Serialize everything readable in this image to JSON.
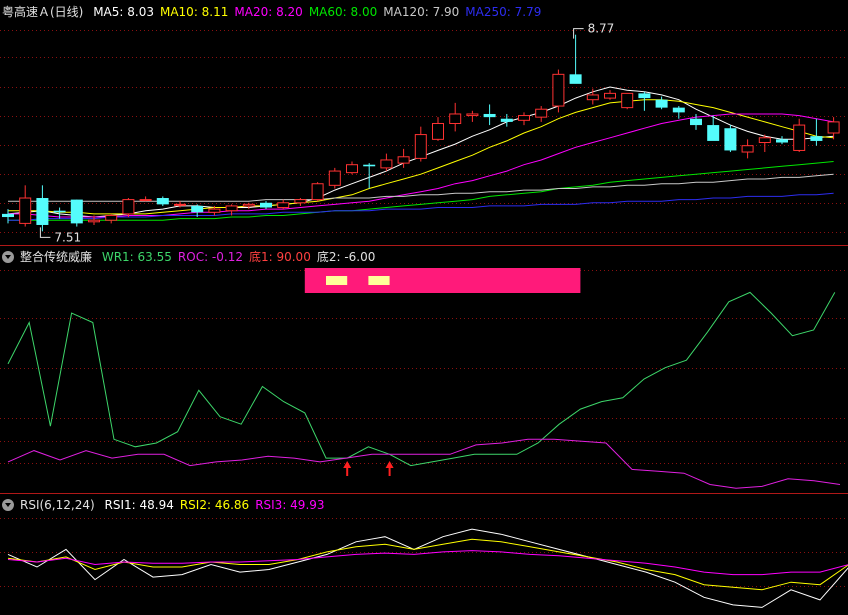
{
  "colors": {
    "bg": "#000000",
    "up": "#ff3232",
    "down": "#54fcfc",
    "ma5": "#ffffff",
    "ma10": "#ffff00",
    "ma20": "#ff00ff",
    "ma60": "#00e600",
    "ma120": "#c8c8c8",
    "ma250": "#2d2df0",
    "wr": "#3dd66a",
    "roc": "#e020e0",
    "label": "#e0e0e0",
    "grid": "#8a1010",
    "sep": "#b01818",
    "band": "#ff1a7a",
    "bandbox": "#ffff99"
  },
  "price_panel": {
    "name": "粤高速Ａ(日线)",
    "legend": [
      {
        "text": "MA5: 8.03",
        "color": "#ffffff"
      },
      {
        "text": "MA10: 8.11",
        "color": "#ffff00"
      },
      {
        "text": "MA20: 8.20",
        "color": "#ff00ff"
      },
      {
        "text": "MA60: 8.00",
        "color": "#00e600"
      },
      {
        "text": "MA120: 7.90",
        "color": "#c8c8c8"
      },
      {
        "text": "MA250: 7.79",
        "color": "#2d2df0"
      }
    ],
    "high_label": "8.77",
    "low_label": "7.51"
  },
  "ind_panel": {
    "name": "整合传统威廉",
    "legend": [
      {
        "text": "WR1: 63.55",
        "color": "#3dd66a"
      },
      {
        "text": "ROC: -0.12",
        "color": "#e020e0"
      },
      {
        "text": "底1: 90.00",
        "color": "#ff4040"
      },
      {
        "text": "底2: -6.00",
        "color": "#e0e0e0"
      }
    ]
  },
  "rsi_panel": {
    "name": "RSI(6,12,24)",
    "legend": [
      {
        "text": "RSI1: 48.94",
        "color": "#ffffff"
      },
      {
        "text": "RSI2: 46.86",
        "color": "#ffff00"
      },
      {
        "text": "RSI3: 49.93",
        "color": "#ff00ff"
      }
    ]
  },
  "chart_data": [
    {
      "type": "candlestick",
      "ylim": [
        7.45,
        8.85
      ],
      "series": [
        {
          "name": "K",
          "ohlc": [
            [
              7.64,
              7.67,
              7.58,
              7.62
            ],
            [
              7.58,
              7.82,
              7.56,
              7.74
            ],
            [
              7.74,
              7.82,
              7.53,
              7.57
            ],
            [
              7.66,
              7.68,
              7.61,
              7.65
            ],
            [
              7.73,
              7.73,
              7.56,
              7.58
            ],
            [
              7.59,
              7.63,
              7.57,
              7.6
            ],
            [
              7.6,
              7.64,
              7.58,
              7.63
            ],
            [
              7.64,
              7.74,
              7.62,
              7.73
            ],
            [
              7.73,
              7.75,
              7.72,
              7.73
            ],
            [
              7.74,
              7.75,
              7.69,
              7.7
            ],
            [
              7.7,
              7.72,
              7.68,
              7.7
            ],
            [
              7.69,
              7.7,
              7.62,
              7.65
            ],
            [
              7.65,
              7.69,
              7.63,
              7.67
            ],
            [
              7.66,
              7.7,
              7.63,
              7.69
            ],
            [
              7.69,
              7.71,
              7.67,
              7.7
            ],
            [
              7.71,
              7.72,
              7.67,
              7.68
            ],
            [
              7.68,
              7.73,
              7.67,
              7.71
            ],
            [
              7.71,
              7.74,
              7.69,
              7.73
            ],
            [
              7.73,
              7.84,
              7.72,
              7.83
            ],
            [
              7.82,
              7.93,
              7.8,
              7.91
            ],
            [
              7.9,
              7.97,
              7.89,
              7.95
            ],
            [
              7.95,
              7.96,
              7.8,
              7.94
            ],
            [
              7.93,
              8.02,
              7.91,
              7.98
            ],
            [
              7.96,
              8.05,
              7.93,
              8.0
            ],
            [
              7.99,
              8.19,
              7.97,
              8.14
            ],
            [
              8.11,
              8.25,
              8.1,
              8.21
            ],
            [
              8.21,
              8.34,
              8.16,
              8.27
            ],
            [
              8.26,
              8.29,
              8.22,
              8.27
            ],
            [
              8.27,
              8.33,
              8.2,
              8.25
            ],
            [
              8.24,
              8.27,
              8.19,
              8.22
            ],
            [
              8.23,
              8.28,
              8.2,
              8.26
            ],
            [
              8.25,
              8.32,
              8.22,
              8.3
            ],
            [
              8.32,
              8.55,
              8.28,
              8.52
            ],
            [
              8.52,
              8.77,
              8.48,
              8.46
            ],
            [
              8.36,
              8.43,
              8.33,
              8.39
            ],
            [
              8.37,
              8.42,
              8.36,
              8.4
            ],
            [
              8.31,
              8.4,
              8.3,
              8.4
            ],
            [
              8.4,
              8.41,
              8.29,
              8.37
            ],
            [
              8.36,
              8.38,
              8.3,
              8.31
            ],
            [
              8.31,
              8.32,
              8.24,
              8.28
            ],
            [
              8.24,
              8.27,
              8.17,
              8.2
            ],
            [
              8.2,
              8.26,
              8.11,
              8.1
            ],
            [
              8.18,
              8.2,
              8.03,
              8.04
            ],
            [
              8.03,
              8.11,
              7.99,
              8.07
            ],
            [
              8.09,
              8.14,
              8.03,
              8.12
            ],
            [
              8.11,
              8.13,
              8.08,
              8.09
            ],
            [
              8.04,
              8.24,
              8.03,
              8.2
            ],
            [
              8.13,
              8.24,
              8.07,
              8.1
            ],
            [
              8.15,
              8.25,
              8.11,
              8.22
            ]
          ]
        },
        {
          "name": "MA5",
          "values": [
            7.64,
            7.65,
            7.66,
            7.64,
            7.63,
            7.62,
            7.63,
            7.64,
            7.66,
            7.67,
            7.69,
            7.69,
            7.68,
            7.68,
            7.68,
            7.69,
            7.7,
            7.71,
            7.74,
            7.79,
            7.83,
            7.87,
            7.91,
            7.96,
            8.0,
            8.04,
            8.08,
            8.13,
            8.17,
            8.22,
            8.25,
            8.28,
            8.32,
            8.37,
            8.41,
            8.44,
            8.42,
            8.41,
            8.39,
            8.36,
            8.3,
            8.25,
            8.2,
            8.16,
            8.13,
            8.11,
            8.11,
            8.12,
            8.13
          ]
        },
        {
          "name": "MA10",
          "values": [
            7.66,
            7.66,
            7.66,
            7.65,
            7.65,
            7.64,
            7.64,
            7.64,
            7.64,
            7.65,
            7.66,
            7.67,
            7.68,
            7.68,
            7.69,
            7.69,
            7.7,
            7.71,
            7.72,
            7.74,
            7.76,
            7.8,
            7.83,
            7.86,
            7.89,
            7.93,
            7.97,
            8.01,
            8.06,
            8.1,
            8.15,
            8.19,
            8.24,
            8.28,
            8.31,
            8.34,
            8.35,
            8.36,
            8.36,
            8.35,
            8.33,
            8.31,
            8.28,
            8.25,
            8.22,
            8.19,
            8.16,
            8.13,
            8.12
          ]
        },
        {
          "name": "MA20",
          "values": [
            7.64,
            7.64,
            7.63,
            7.62,
            7.62,
            7.62,
            7.62,
            7.63,
            7.63,
            7.63,
            7.64,
            7.65,
            7.65,
            7.66,
            7.66,
            7.67,
            7.67,
            7.68,
            7.69,
            7.7,
            7.71,
            7.72,
            7.74,
            7.76,
            7.78,
            7.8,
            7.83,
            7.85,
            7.88,
            7.91,
            7.95,
            7.98,
            8.02,
            8.06,
            8.09,
            8.12,
            8.15,
            8.18,
            8.21,
            8.23,
            8.25,
            8.26,
            8.27,
            8.27,
            8.27,
            8.27,
            8.26,
            8.24,
            8.22
          ]
        },
        {
          "name": "MA60",
          "values": [
            7.6,
            7.6,
            7.6,
            7.6,
            7.6,
            7.6,
            7.6,
            7.6,
            7.6,
            7.6,
            7.61,
            7.61,
            7.61,
            7.62,
            7.62,
            7.63,
            7.63,
            7.64,
            7.65,
            7.66,
            7.66,
            7.67,
            7.68,
            7.69,
            7.7,
            7.71,
            7.72,
            7.73,
            7.75,
            7.76,
            7.77,
            7.78,
            7.8,
            7.81,
            7.82,
            7.84,
            7.85,
            7.86,
            7.87,
            7.88,
            7.89,
            7.9,
            7.91,
            7.92,
            7.93,
            7.94,
            7.95,
            7.96,
            7.97
          ]
        },
        {
          "name": "MA120",
          "values": [
            7.72,
            7.72,
            7.72,
            7.72,
            7.72,
            7.72,
            7.72,
            7.72,
            7.72,
            7.72,
            7.72,
            7.72,
            7.72,
            7.72,
            7.72,
            7.73,
            7.73,
            7.73,
            7.73,
            7.74,
            7.74,
            7.74,
            7.75,
            7.75,
            7.76,
            7.76,
            7.77,
            7.77,
            7.78,
            7.78,
            7.79,
            7.79,
            7.8,
            7.8,
            7.81,
            7.81,
            7.82,
            7.82,
            7.83,
            7.83,
            7.84,
            7.84,
            7.85,
            7.86,
            7.86,
            7.87,
            7.87,
            7.88,
            7.89
          ]
        },
        {
          "name": "MA250",
          "values": [
            7.6,
            7.6,
            7.61,
            7.61,
            7.61,
            7.61,
            7.62,
            7.62,
            7.62,
            7.63,
            7.63,
            7.63,
            7.63,
            7.64,
            7.64,
            7.64,
            7.65,
            7.65,
            7.65,
            7.66,
            7.66,
            7.66,
            7.67,
            7.67,
            7.67,
            7.68,
            7.68,
            7.68,
            7.69,
            7.69,
            7.69,
            7.7,
            7.7,
            7.7,
            7.71,
            7.71,
            7.72,
            7.72,
            7.72,
            7.73,
            7.73,
            7.74,
            7.74,
            7.75,
            7.75,
            7.75,
            7.76,
            7.76,
            7.77
          ]
        }
      ]
    },
    {
      "type": "line",
      "ylim": [
        -10,
        110
      ],
      "series": [
        {
          "name": "WR1",
          "values": [
            58,
            80,
            25,
            85,
            80,
            18,
            14,
            16,
            22,
            44,
            30,
            26,
            46,
            38,
            32,
            8,
            8,
            14,
            10,
            4,
            6,
            8,
            10,
            10,
            10,
            16,
            26,
            34,
            38,
            40,
            50,
            56,
            60,
            75,
            91,
            96,
            85,
            73,
            76,
            96
          ]
        },
        {
          "name": "ROC",
          "values": [
            6,
            12,
            7,
            12,
            8,
            10,
            10,
            4,
            6,
            7,
            9,
            8,
            6,
            8,
            10,
            10,
            10,
            10,
            15,
            16,
            18,
            18,
            17,
            16,
            2,
            1,
            0,
            -6,
            -8,
            -7,
            -3,
            -4,
            -6
          ]
        }
      ],
      "markers": [
        {
          "x": 16,
          "symbol": "up-arrow"
        },
        {
          "x": 18,
          "symbol": "up-arrow"
        }
      ],
      "band": {
        "from": 14,
        "to": 27,
        "boxes": [
          {
            "from": 15,
            "to": 16
          },
          {
            "from": 17,
            "to": 18
          }
        ]
      }
    },
    {
      "type": "line",
      "ylim": [
        10,
        90
      ],
      "series": [
        {
          "name": "RSI1",
          "values": [
            58,
            48,
            62,
            38,
            54,
            40,
            42,
            50,
            44,
            46,
            52,
            58,
            68,
            72,
            62,
            72,
            78,
            74,
            68,
            62,
            56,
            50,
            44,
            36,
            24,
            18,
            16,
            30,
            22,
            48
          ]
        },
        {
          "name": "RSI2",
          "values": [
            55,
            52,
            56,
            46,
            52,
            48,
            48,
            52,
            50,
            50,
            54,
            60,
            64,
            66,
            62,
            66,
            70,
            68,
            64,
            60,
            56,
            52,
            46,
            42,
            34,
            32,
            30,
            36,
            34,
            50
          ]
        },
        {
          "name": "RSI3",
          "values": [
            54,
            52,
            55,
            50,
            52,
            51,
            51,
            52,
            52,
            53,
            54,
            56,
            58,
            59,
            58,
            60,
            61,
            60,
            58,
            57,
            55,
            53,
            51,
            48,
            44,
            42,
            42,
            44,
            44,
            50
          ]
        }
      ]
    }
  ]
}
